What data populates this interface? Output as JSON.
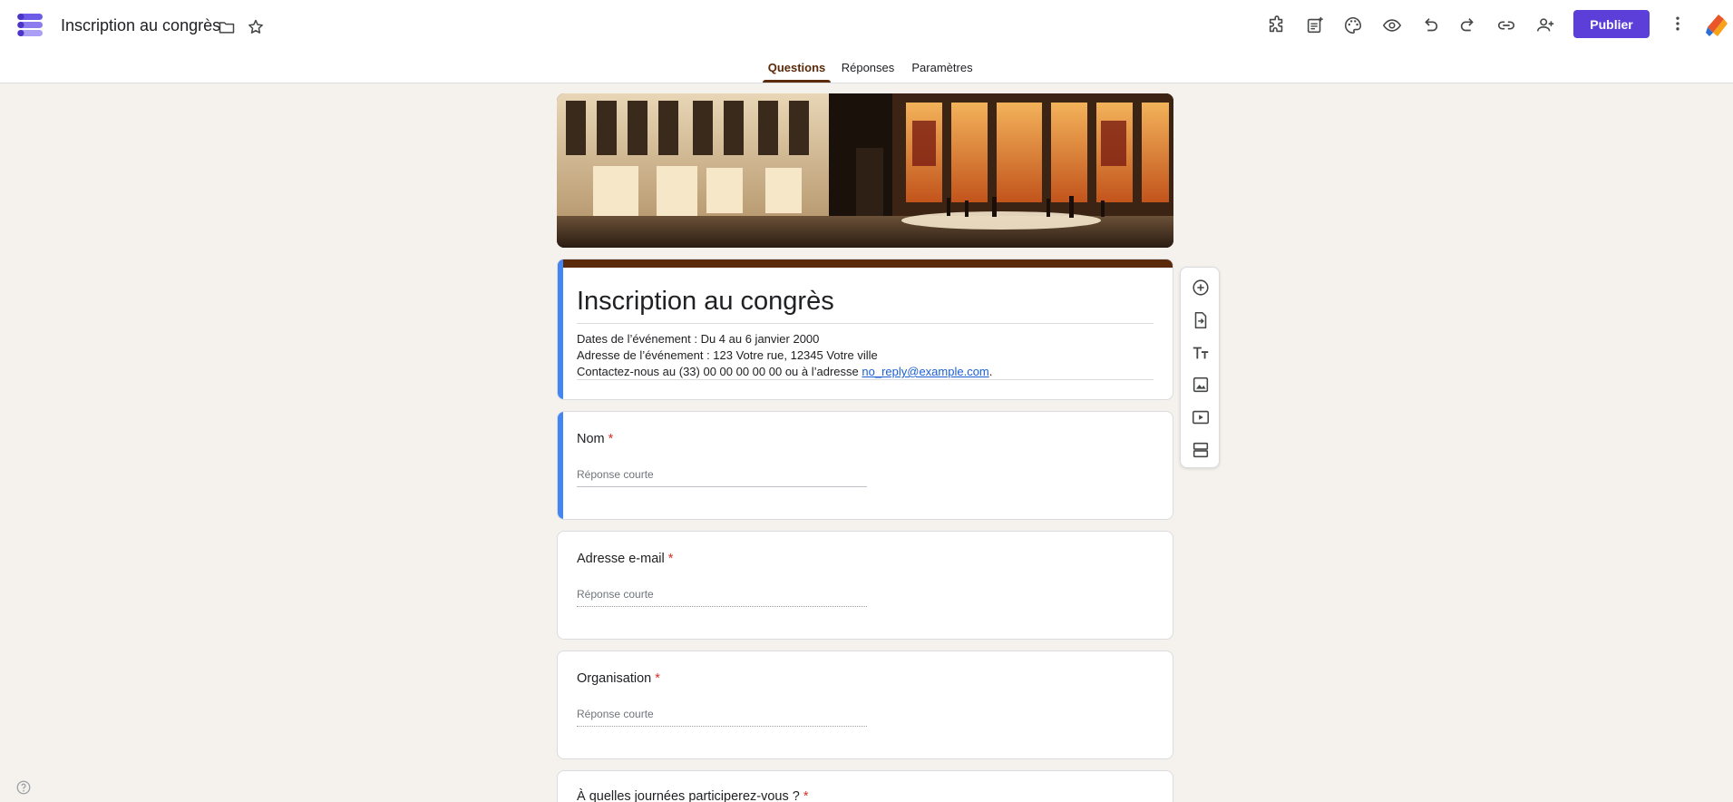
{
  "header": {
    "doc_title": "Inscription au congrès",
    "publish_label": "Publier",
    "icons": [
      "forms-logo-icon",
      "folder-icon",
      "star-icon",
      "addons-icon",
      "add-to-sheet-icon",
      "palette-icon",
      "preview-eye-icon",
      "undo-icon",
      "redo-icon",
      "link-icon",
      "add-collaborator-icon",
      "more-vert-icon",
      "account-logo-icon"
    ]
  },
  "tabs": {
    "questions": "Questions",
    "reponses": "Réponses",
    "parametres": "Paramètres",
    "active": "Questions"
  },
  "form": {
    "title": "Inscription au congrès",
    "description": {
      "line1": "Dates de l’événement : Du 4 au 6 janvier 2000",
      "line2": "Adresse de l’événement : 123 Votre rue, 12345 Votre ville",
      "line3_prefix": "Contactez-nous au (33) 00 00 00 00 00 ou à l’adresse ",
      "email": "no_reply@example.com",
      "line3_suffix": "."
    },
    "questions": [
      {
        "label": "Nom",
        "required_mark": "*",
        "placeholder": "Réponse courte"
      },
      {
        "label": "Adresse e-mail",
        "required_mark": "*",
        "placeholder": "Réponse courte"
      },
      {
        "label": "Organisation",
        "required_mark": "*",
        "placeholder": "Réponse courte"
      },
      {
        "label": "À quelles journées participerez-vous ?",
        "required_mark": "*"
      }
    ]
  },
  "side_toolbar": {
    "icons": [
      "add-question-icon",
      "import-questions-icon",
      "add-title-icon",
      "add-image-icon",
      "add-video-icon",
      "add-section-icon"
    ]
  },
  "colors": {
    "theme": "#5a2a0a",
    "accent_focus": "#4285f4",
    "publish": "#5b3fd8",
    "background": "#f5f2ee"
  }
}
